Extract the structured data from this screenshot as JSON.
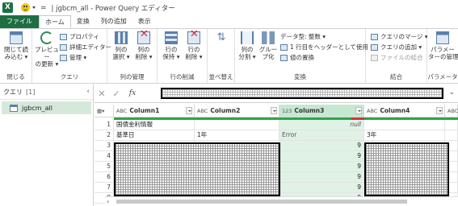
{
  "titlebar": {
    "app_logo": "X",
    "quick_access_eq": "=",
    "title": "| jgbcm_all - Power Query エディター"
  },
  "tabs": [
    {
      "label": "ファイル"
    },
    {
      "label": "ホーム"
    },
    {
      "label": "変換"
    },
    {
      "label": "列の追加"
    },
    {
      "label": "表示"
    }
  ],
  "ribbon": {
    "close": {
      "btn1": "閉じて読",
      "btn1b": "み込む ▾",
      "group": "閉じる"
    },
    "query": {
      "preview": "プレビュー",
      "preview_b": "の更新 ▾",
      "properties": "プロパティ",
      "advanced_editor": "詳細エディター",
      "manage": "管理 ▾",
      "group": "クエリ"
    },
    "columns": {
      "select": "列の",
      "select_b": "選択 ▾",
      "remove": "列の",
      "remove_b": "削除 ▾",
      "group": "列の管理"
    },
    "rows": {
      "keep": "行の",
      "keep_b": "保持 ▾",
      "remove": "行の",
      "remove_b": "削除 ▾",
      "group": "行の削減"
    },
    "sort": {
      "group": "並べ替え"
    },
    "transform": {
      "split": "列の",
      "split_b": "分割 ▾",
      "group_by": "グルー",
      "group_by_b": "プ化",
      "datatype": "データ型: 整数 ▾",
      "first_row_header": "1 行目をヘッダーとして使用 ▾",
      "replace": "値の置換",
      "group": "変換"
    },
    "combine": {
      "merge": "クエリのマージ ▾",
      "append": "クエリの追加 ▾",
      "combine_files": "ファイルの結合",
      "group": "結合"
    },
    "params": {
      "manage": "パラメー",
      "manage_b": "ターの管理 ▾",
      "group": "パラメータ"
    }
  },
  "queries_pane": {
    "title": "クエリ",
    "count": "[1]",
    "items": [
      {
        "label": "jgbcm_all"
      }
    ]
  },
  "grid": {
    "columns": [
      {
        "type": "ABC",
        "label": "Column1"
      },
      {
        "type": "ABC",
        "label": "Column2"
      },
      {
        "type": "123",
        "label": "Column3"
      },
      {
        "type": "ABC",
        "label": "Column4"
      },
      {
        "type": "ABC",
        "label": ""
      }
    ],
    "rows": [
      {
        "n": "1",
        "c1": "国債金利情報",
        "c2": "",
        "c3": "null",
        "c4": ""
      },
      {
        "n": "2",
        "c1": "基準日",
        "c2": "1年",
        "c3": "Error",
        "c4": "3年"
      },
      {
        "n": "3",
        "c1": "",
        "c2": "",
        "c3": "9",
        "c4": ""
      },
      {
        "n": "4",
        "c1": "",
        "c2": "",
        "c3": "9",
        "c4": ""
      },
      {
        "n": "5",
        "c1": "",
        "c2": "",
        "c3": "9",
        "c4": ""
      },
      {
        "n": "6",
        "c1": "",
        "c2": "",
        "c3": "9",
        "c4": ""
      },
      {
        "n": "7",
        "c1": "",
        "c2": "",
        "c3": "9",
        "c4": ""
      },
      {
        "n": "8",
        "c1": "",
        "c2": "",
        "c3": "9",
        "c4": ""
      }
    ]
  },
  "colors": {
    "excel_green": "#1d6f42",
    "selection_green": "#d5e9db",
    "quality_green": "#2ea44f",
    "error_red": "#d13438"
  }
}
